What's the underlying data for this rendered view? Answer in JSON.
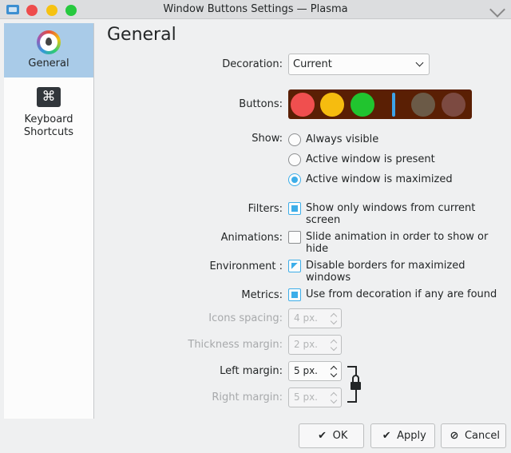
{
  "window": {
    "title": "Window Buttons Settings — Plasma",
    "buttons": {
      "close_color": "#ee4c4c",
      "minimize_color": "#f6c211",
      "maximize_color": "#27c93f"
    }
  },
  "sidebar": {
    "items": [
      {
        "label": "General",
        "icon": "color-drop-icon",
        "active": true
      },
      {
        "label": "Keyboard Shortcuts",
        "icon": "command-key-icon",
        "active": false
      }
    ]
  },
  "page": {
    "title": "General"
  },
  "form": {
    "decoration": {
      "label": "Decoration:",
      "value": "Current"
    },
    "buttons": {
      "label": "Buttons:",
      "background": "#5a1f04",
      "active_colors": [
        "#f04f4f",
        "#f6bc0f",
        "#21c42f"
      ],
      "inactive_colors": [
        "#6b5a47",
        "#7c4a41"
      ],
      "separator_color": "#3da3e9"
    },
    "show": {
      "label": "Show:",
      "options": [
        "Always visible",
        "Active window is present",
        "Active window is maximized"
      ],
      "selected_index": 2
    },
    "filters": {
      "label": "Filters:",
      "text": "Show only windows from current screen",
      "checked": true
    },
    "animations": {
      "label": "Animations:",
      "text": "Slide animation in order to show or hide",
      "checked": false
    },
    "environment": {
      "label": "Environment :",
      "text": "Disable borders for maximized windows",
      "checked": "partial"
    },
    "metrics": {
      "label": "Metrics:",
      "text": "Use from decoration if any are found",
      "checked": true
    },
    "icons_spacing": {
      "label": "Icons spacing:",
      "value": "4 px.",
      "enabled": false
    },
    "thickness_margin": {
      "label": "Thickness margin:",
      "value": "2 px.",
      "enabled": false
    },
    "left_margin": {
      "label": "Left margin:",
      "value": "5 px.",
      "enabled": true
    },
    "right_margin": {
      "label": "Right margin:",
      "value": "5 px.",
      "enabled": false
    }
  },
  "footer": {
    "ok": "OK",
    "apply": "Apply",
    "cancel": "Cancel"
  },
  "colors": {
    "accent": "#3daee9",
    "selection": "#a9cbe8"
  }
}
